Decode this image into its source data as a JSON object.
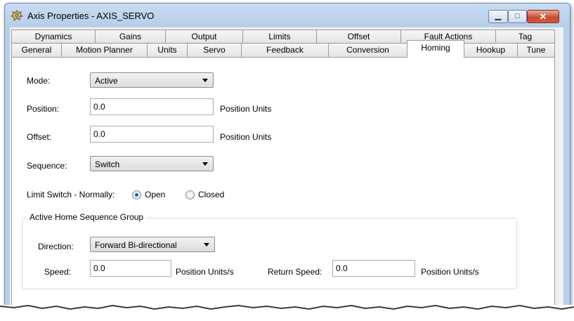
{
  "window": {
    "title": "Axis Properties - AXIS_SERVO",
    "icon": "gear-icon"
  },
  "controls": {
    "minimize": "▁",
    "maximize": "□",
    "close": "✕"
  },
  "tabs_row1": [
    "Dynamics",
    "Gains",
    "Output",
    "Limits",
    "Offset",
    "Fault Actions",
    "Tag"
  ],
  "tabs_row2": [
    "General",
    "Motion Planner",
    "Units",
    "Servo",
    "Feedback",
    "Conversion",
    "Homing",
    "Hookup",
    "Tune"
  ],
  "active_tab": "Homing",
  "form": {
    "mode_label": "Mode:",
    "mode_value": "Active",
    "position_label": "Position:",
    "position_value": "0.0",
    "position_units": "Position Units",
    "offset_label": "Offset:",
    "offset_value": "0.0",
    "offset_units": "Position Units",
    "sequence_label": "Sequence:",
    "sequence_value": "Switch",
    "limit_switch_label": "Limit Switch - Normally:",
    "open_label": "Open",
    "closed_label": "Closed",
    "limit_switch_selected": "Open"
  },
  "group": {
    "title": "Active Home Sequence Group",
    "direction_label": "Direction:",
    "direction_value": "Forward Bi-directional",
    "speed_label": "Speed:",
    "speed_value": "0.0",
    "speed_units": "Position Units/s",
    "return_speed_label": "Return Speed:",
    "return_speed_value": "0.0",
    "return_speed_units": "Position Units/s"
  }
}
